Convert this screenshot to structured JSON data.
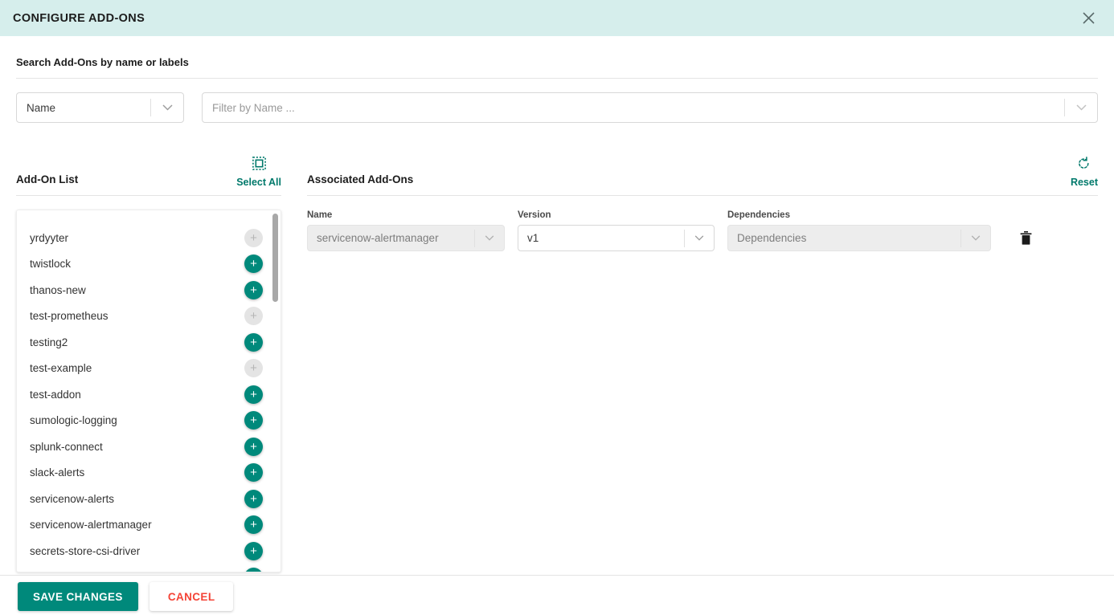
{
  "header": {
    "title": "CONFIGURE ADD-ONS",
    "close_icon": "close-icon"
  },
  "search": {
    "label": "Search Add-Ons by name or labels",
    "type_select": {
      "value": "Name",
      "icon": "chevron-down-icon"
    },
    "filter_input": {
      "placeholder": "Filter by Name ...",
      "value": "",
      "icon": "chevron-down-icon"
    }
  },
  "left_panel": {
    "title": "Add-On List",
    "select_all": {
      "label": "Select All",
      "icon": "select-all-icon"
    },
    "items": [
      {
        "name": "yrdyyter",
        "add_enabled": false
      },
      {
        "name": "twistlock",
        "add_enabled": true
      },
      {
        "name": "thanos-new",
        "add_enabled": true
      },
      {
        "name": "test-prometheus",
        "add_enabled": false
      },
      {
        "name": "testing2",
        "add_enabled": true
      },
      {
        "name": "test-example",
        "add_enabled": false
      },
      {
        "name": "test-addon",
        "add_enabled": true
      },
      {
        "name": "sumologic-logging",
        "add_enabled": true
      },
      {
        "name": "splunk-connect",
        "add_enabled": true
      },
      {
        "name": "slack-alerts",
        "add_enabled": true
      },
      {
        "name": "servicenow-alerts",
        "add_enabled": true
      },
      {
        "name": "servicenow-alertmanager",
        "add_enabled": true
      },
      {
        "name": "secrets-store-csi-driver",
        "add_enabled": true
      },
      {
        "name": "",
        "add_enabled": true
      }
    ],
    "add_button_glyph": "+"
  },
  "right_panel": {
    "title": "Associated Add-Ons",
    "reset": {
      "label": "Reset",
      "icon": "reset-icon"
    },
    "columns": {
      "name": "Name",
      "version": "Version",
      "dependencies": "Dependencies"
    },
    "rows": [
      {
        "name_value": "servicenow-alertmanager",
        "name_disabled": true,
        "version_value": "v1",
        "version_disabled": false,
        "dependencies_value": "Dependencies",
        "dependencies_disabled": true,
        "delete_icon": "trash-icon"
      }
    ]
  },
  "footer": {
    "save_label": "SAVE CHANGES",
    "cancel_label": "CANCEL"
  },
  "colors": {
    "header_bg": "#d6eeec",
    "accent_teal": "#00897b",
    "link_teal": "#00796b",
    "cancel_red": "#f44336",
    "disabled_gray": "#e4e4e4"
  }
}
